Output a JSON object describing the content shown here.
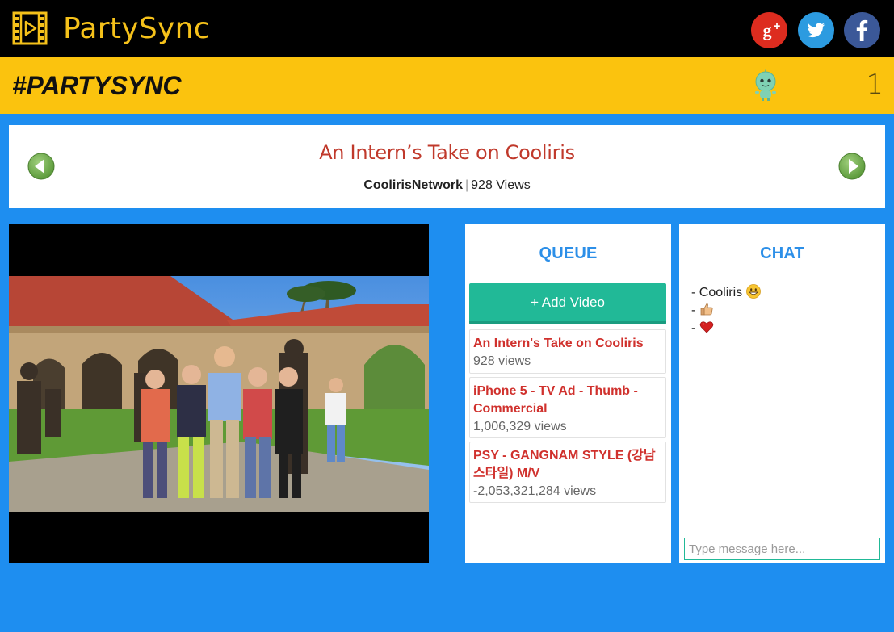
{
  "header": {
    "app_title": "PartySync",
    "logo_icon": "film-strip-play-icon",
    "social": [
      {
        "name": "google-plus-icon",
        "color": "#dd2c1f"
      },
      {
        "name": "twitter-icon",
        "color": "#2c9be0"
      },
      {
        "name": "facebook-icon",
        "color": "#3b5898"
      }
    ]
  },
  "room": {
    "hashtag": "#PARTYSYNC",
    "user_count": "1"
  },
  "now_playing": {
    "title": "An Intern’s Take on Cooliris",
    "channel": "CoolirisNetwork",
    "separator": "|",
    "views": "928 Views"
  },
  "queue": {
    "heading": "QUEUE",
    "add_label": "+ Add Video",
    "items": [
      {
        "title": "An Intern's Take on Cooliris",
        "views": "928 views"
      },
      {
        "title": "iPhone 5 - TV Ad - Thumb - Commercial",
        "views": "1,006,329 views"
      },
      {
        "title": "PSY - GANGNAM STYLE (강남스타일) M/V",
        "views": "-2,053,321,284 views"
      }
    ]
  },
  "chat": {
    "heading": "CHAT",
    "messages": [
      {
        "prefix": "- ",
        "text": "Cooliris ",
        "emoji": "grinning-face-icon"
      },
      {
        "prefix": "- ",
        "text": "",
        "emoji": "thumbs-up-icon"
      },
      {
        "prefix": "- ",
        "text": "",
        "emoji": "red-heart-icon"
      }
    ],
    "input_placeholder": "Type message here..."
  },
  "colors": {
    "page_bg": "#1e8ef0",
    "header_bg": "#000000",
    "brand_yellow": "#fbc30e",
    "accent_red": "#c0392b",
    "accent_teal": "#21b997",
    "accent_blue": "#2c8fe8"
  }
}
